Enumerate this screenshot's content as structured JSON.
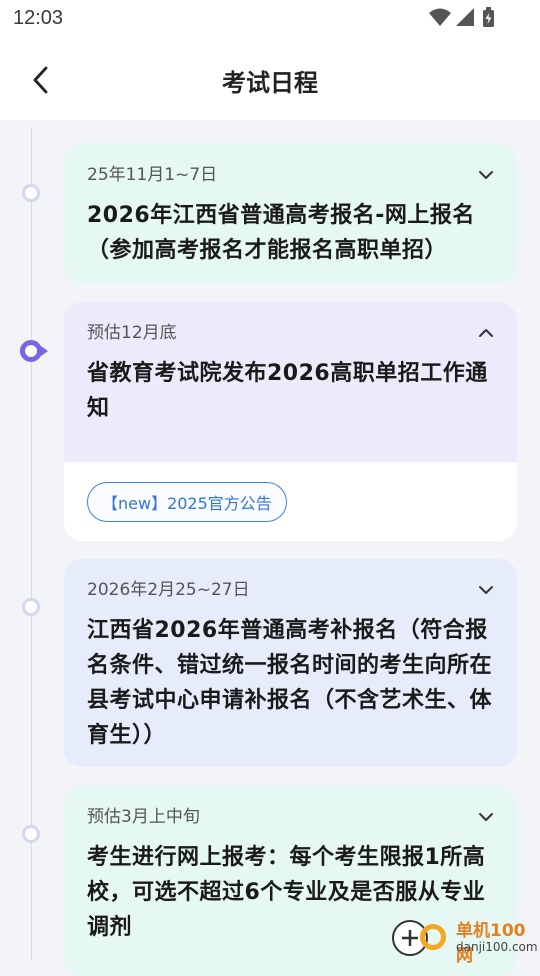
{
  "status": {
    "time": "12:03"
  },
  "header": {
    "title": "考试日程"
  },
  "events": [
    {
      "date": "25年11月1~7日",
      "title": "2026年江西省普通高考报名-网上报名（参加高考报名才能报名高职单招）",
      "expanded": false
    },
    {
      "date": "预估12月底",
      "title": "省教育考试院发布2026高职单招工作通知",
      "expanded": true,
      "link_label": "【new】2025官方公告"
    },
    {
      "date": "2026年2月25~27日",
      "title": "江西省2026年普通高考补报名（符合报名条件、错过统一报名时间的考生向所在县考试中心申请补报名（不含艺术生、体育生））",
      "expanded": false
    },
    {
      "date": "预估3月上中旬",
      "title": "考生进行网上报考：每个考生限报1所高校，可选不超过6个专业及是否服从专业调剂",
      "expanded": false
    }
  ],
  "watermark": {
    "brand": "单机100网",
    "domain": "danji100.com"
  },
  "colors": {
    "accent": "#7b63e8",
    "link": "#2f75dd",
    "mint": "#e6f8f4",
    "lavender": "#eeeafb",
    "blue": "#e6ecfa"
  },
  "icons": [
    "wifi-icon",
    "signal-icon",
    "battery-icon",
    "back-arrow-icon",
    "chevron-down-icon",
    "chevron-up-icon"
  ]
}
